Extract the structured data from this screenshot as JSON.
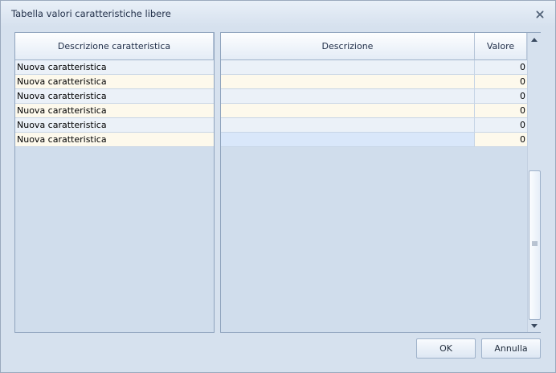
{
  "window": {
    "title": "Tabella valori caratteristiche libere"
  },
  "left_grid": {
    "header": "Descrizione caratteristica",
    "rows": [
      "Nuova caratteristica",
      "Nuova caratteristica",
      "Nuova caratteristica",
      "Nuova caratteristica",
      "Nuova caratteristica",
      "Nuova caratteristica"
    ]
  },
  "right_grid": {
    "headers": [
      "Descrizione",
      "Valore"
    ],
    "rows": [
      {
        "descrizione": "",
        "valore": "0"
      },
      {
        "descrizione": "",
        "valore": "0"
      },
      {
        "descrizione": "",
        "valore": "0"
      },
      {
        "descrizione": "",
        "valore": "0"
      },
      {
        "descrizione": "",
        "valore": "0"
      },
      {
        "descrizione": "",
        "valore": "0"
      }
    ],
    "selected_row": 5
  },
  "buttons": {
    "ok": "OK",
    "cancel": "Annulla"
  },
  "icons": {
    "close": "close-icon",
    "scroll_up": "arrow-up-icon",
    "scroll_down": "arrow-down-icon",
    "grip": "grip-icon"
  },
  "colors": {
    "header_bg": "#e4ecf6",
    "row_alt_a": "#ebf1f8",
    "row_alt_b": "#fdf9ec",
    "selected": "#d9e7fa",
    "border": "#8ea3bd"
  }
}
